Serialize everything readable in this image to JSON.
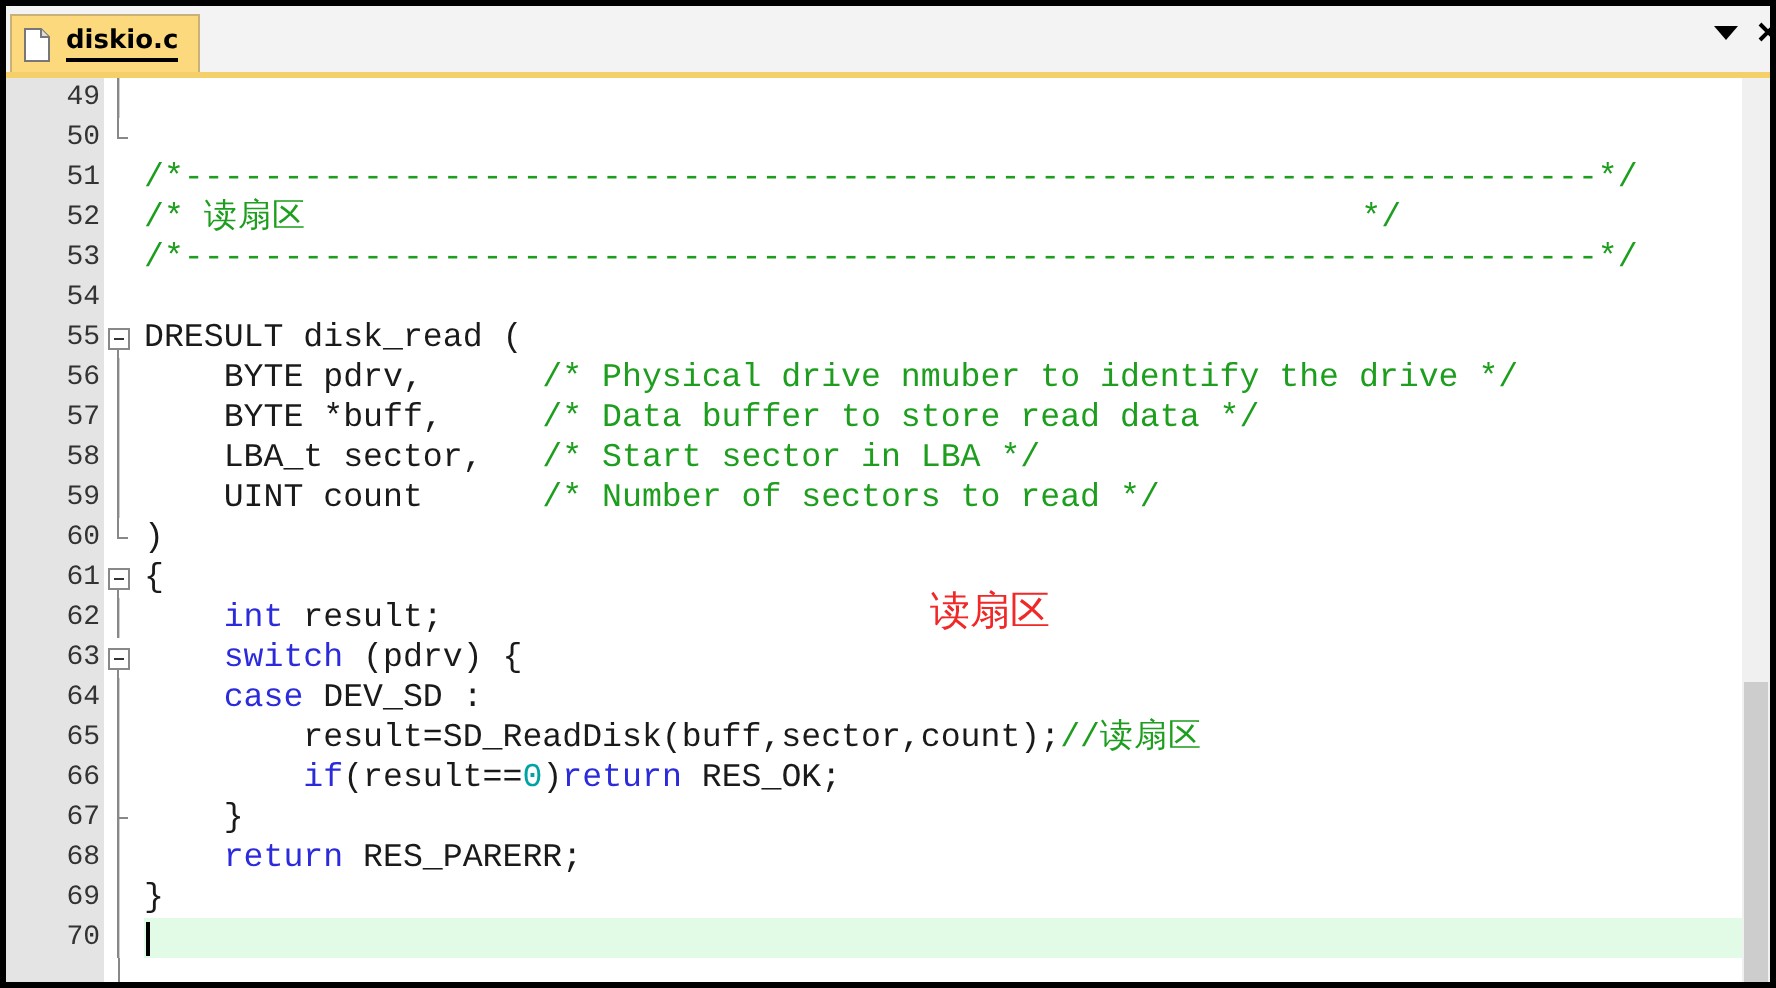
{
  "tab": {
    "title": "diskio.c",
    "selected": true
  },
  "annotation": "读扇区",
  "lines": [
    {
      "number": "49",
      "fold_start": false,
      "fold_guide": true,
      "fold_end": false,
      "current": false
    },
    {
      "number": "50",
      "fold_start": false,
      "fold_guide": false,
      "fold_end": true,
      "current": false
    },
    {
      "number": "51",
      "fold_start": false,
      "fold_guide": false,
      "fold_end": false,
      "current": false,
      "tokens": [
        {
          "kind": "comment",
          "text": "/*-----------------------------------------------------------------------*/"
        }
      ]
    },
    {
      "number": "52",
      "fold_start": false,
      "fold_guide": false,
      "fold_end": false,
      "current": false,
      "tokens": [
        {
          "kind": "comment",
          "text": "/* 读扇区                                                     */"
        }
      ]
    },
    {
      "number": "53",
      "fold_start": false,
      "fold_guide": false,
      "fold_end": false,
      "current": false,
      "tokens": [
        {
          "kind": "comment",
          "text": "/*-----------------------------------------------------------------------*/"
        }
      ]
    },
    {
      "number": "54",
      "fold_start": false,
      "fold_guide": false,
      "fold_end": false,
      "current": false
    },
    {
      "number": "55",
      "fold_start": true,
      "fold_guide": false,
      "fold_end": false,
      "current": false,
      "tokens": [
        {
          "kind": "plain",
          "text": "DRESULT disk_read ("
        }
      ]
    },
    {
      "number": "56",
      "fold_start": false,
      "fold_guide": true,
      "fold_end": false,
      "current": false,
      "tokens": [
        {
          "kind": "plain",
          "text": "    BYTE pdrv,      "
        },
        {
          "kind": "comment",
          "text": "/* Physical drive nmuber to identify the drive */"
        }
      ]
    },
    {
      "number": "57",
      "fold_start": false,
      "fold_guide": true,
      "fold_end": false,
      "current": false,
      "tokens": [
        {
          "kind": "plain",
          "text": "    BYTE *buff,     "
        },
        {
          "kind": "comment",
          "text": "/* Data buffer to store read data */"
        }
      ]
    },
    {
      "number": "58",
      "fold_start": false,
      "fold_guide": true,
      "fold_end": false,
      "current": false,
      "tokens": [
        {
          "kind": "plain",
          "text": "    LBA_t sector,   "
        },
        {
          "kind": "comment",
          "text": "/* Start sector in LBA */"
        }
      ]
    },
    {
      "number": "59",
      "fold_start": false,
      "fold_guide": true,
      "fold_end": false,
      "current": false,
      "tokens": [
        {
          "kind": "plain",
          "text": "    UINT count      "
        },
        {
          "kind": "comment",
          "text": "/* Number of sectors to read */"
        }
      ]
    },
    {
      "number": "60",
      "fold_start": false,
      "fold_guide": false,
      "fold_end": true,
      "current": false,
      "tokens": [
        {
          "kind": "plain",
          "text": ")"
        }
      ]
    },
    {
      "number": "61",
      "fold_start": true,
      "fold_guide": false,
      "fold_end": false,
      "current": false,
      "tokens": [
        {
          "kind": "plain",
          "text": "{"
        }
      ]
    },
    {
      "number": "62",
      "fold_start": false,
      "fold_guide": true,
      "fold_end": false,
      "current": false,
      "tokens": [
        {
          "kind": "keyword",
          "text": "    int"
        },
        {
          "kind": "plain",
          "text": " result;"
        }
      ]
    },
    {
      "number": "63",
      "fold_start": true,
      "fold_guide": false,
      "fold_end": false,
      "current": false,
      "tokens": [
        {
          "kind": "keyword",
          "text": "    switch"
        },
        {
          "kind": "plain",
          "text": " (pdrv) {"
        }
      ]
    },
    {
      "number": "64",
      "fold_start": false,
      "fold_guide": true,
      "fold_end": false,
      "current": false,
      "tokens": [
        {
          "kind": "keyword",
          "text": "    case"
        },
        {
          "kind": "plain",
          "text": " DEV_SD :"
        }
      ]
    },
    {
      "number": "65",
      "fold_start": false,
      "fold_guide": true,
      "fold_end": false,
      "current": false,
      "tokens": [
        {
          "kind": "plain",
          "text": "        result=SD_ReadDisk(buff,sector,count);"
        },
        {
          "kind": "comment",
          "text": "//读扇区"
        }
      ]
    },
    {
      "number": "66",
      "fold_start": false,
      "fold_guide": true,
      "fold_end": false,
      "current": false,
      "tokens": [
        {
          "kind": "keyword",
          "text": "        if"
        },
        {
          "kind": "plain",
          "text": "(result=="
        },
        {
          "kind": "number",
          "text": "0"
        },
        {
          "kind": "plain",
          "text": ")"
        },
        {
          "kind": "keyword",
          "text": "return"
        },
        {
          "kind": "plain",
          "text": " RES_OK;"
        }
      ]
    },
    {
      "number": "67",
      "fold_start": false,
      "fold_guide": true,
      "fold_end": true,
      "current": false,
      "tokens": [
        {
          "kind": "plain",
          "text": "    }"
        }
      ]
    },
    {
      "number": "68",
      "fold_start": false,
      "fold_guide": true,
      "fold_end": false,
      "current": false,
      "tokens": [
        {
          "kind": "keyword",
          "text": "    return"
        },
        {
          "kind": "plain",
          "text": " RES_PARERR;"
        }
      ]
    },
    {
      "number": "69",
      "fold_start": false,
      "fold_guide": true,
      "fold_end": false,
      "current": false,
      "tokens": [
        {
          "kind": "plain",
          "text": "}"
        }
      ]
    },
    {
      "number": "70",
      "fold_start": false,
      "fold_guide": true,
      "fold_end": false,
      "current": true
    }
  ]
}
